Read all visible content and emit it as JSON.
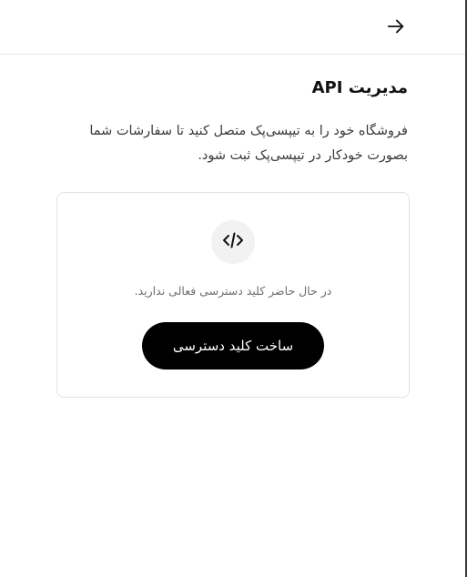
{
  "header": {
    "back_icon": "arrow-right-icon"
  },
  "page": {
    "title": "مدیریت API",
    "description": "فروشگاه خود را به تیپسی‌پک متصل کنید تا سفارشات شما بصورت خودکار در تیپسی‌پک ثبت شود."
  },
  "empty_state": {
    "icon": "code-icon",
    "message": "در حال حاضر کلید دسترسی فعالی ندارید.",
    "create_button_label": "ساخت کلید دسترسی"
  },
  "colors": {
    "primary_button": "#000000",
    "primary_button_text": "#ffffff",
    "card_border": "#e3e3e3",
    "icon_circle_bg": "#f2f2f2",
    "muted_text": "#6f6f6f"
  }
}
